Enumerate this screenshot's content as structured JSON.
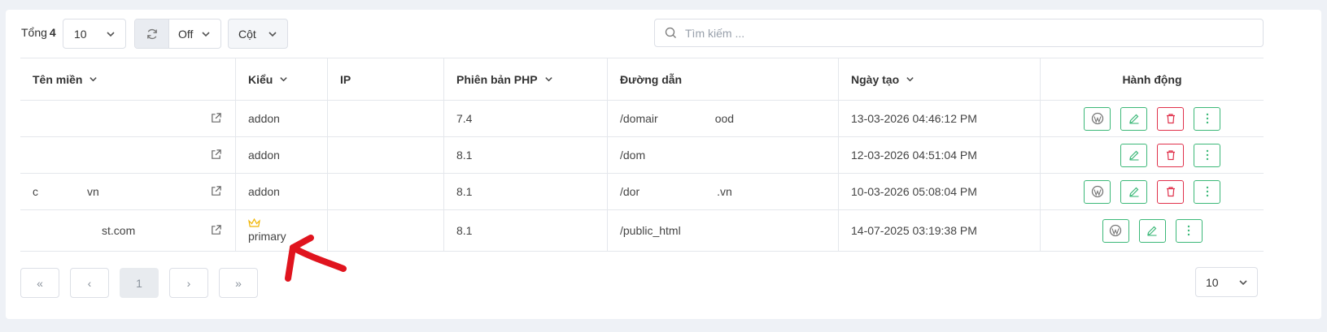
{
  "toolbar": {
    "total_label": "Tổng",
    "total_count": "4",
    "page_size": "10",
    "refresh_state": "Off",
    "columns_label": "Cột",
    "search_placeholder": "Tìm kiếm ..."
  },
  "table": {
    "headers": {
      "domain": "Tên miền",
      "type": "Kiểu",
      "ip": "IP",
      "php": "Phiên bản PHP",
      "path": "Đường dẫn",
      "created": "Ngày tạo",
      "actions": "Hành động"
    },
    "rows": [
      {
        "domain": "",
        "type": "addon",
        "ip": "",
        "php": "7.4",
        "path": "/domair",
        "path_tail": "ood",
        "created": "13-03-2026 04:46:12 PM"
      },
      {
        "domain": "",
        "type": "addon",
        "ip": "",
        "php": "8.1",
        "path": "/dom",
        "path_tail": "",
        "created": "12-03-2026 04:51:04 PM"
      },
      {
        "domain": "c",
        "domain_tail": "vn",
        "type": "addon",
        "ip": "",
        "php": "8.1",
        "path": "/dor",
        "path_tail": ".vn",
        "created": "10-03-2026 05:08:04 PM"
      },
      {
        "domain": "",
        "domain_tail": "st.com",
        "type": "primary",
        "ip": "",
        "php": "8.1",
        "path": "/public_html",
        "path_tail": "",
        "created": "14-07-2025 03:19:38 PM"
      }
    ]
  },
  "pagination": {
    "first": "«",
    "prev": "‹",
    "current": "1",
    "next": "›",
    "last": "»",
    "page_size": "10"
  },
  "colors": {
    "accent_green": "#3cb878",
    "accent_red": "#e0314b",
    "crown": "#f0b400",
    "annotation": "#e0141e"
  }
}
